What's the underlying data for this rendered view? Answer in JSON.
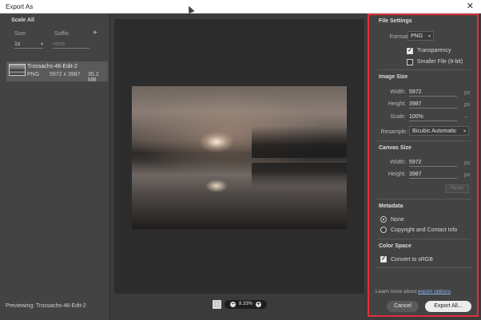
{
  "window": {
    "title": "Export As",
    "close_glyph": "✕"
  },
  "left": {
    "heading": "Scale All",
    "size_label": "Size:",
    "suffix_label": "Suffix:",
    "add_glyph": "+",
    "size_value": "1x",
    "suffix_placeholder": "none",
    "file": {
      "name": "Trossachs-46-Edit-2",
      "type": "PNG",
      "dimensions": "5972 x 3987",
      "size": "35.2 MB"
    },
    "previewing": "Previewing: Trossachs-46-Edit-2"
  },
  "zoom": {
    "value": "8.33%",
    "minus": "−",
    "plus": "+",
    "crop_glyph": "⬚"
  },
  "file_settings": {
    "title": "File Settings",
    "format_label": "Format:",
    "format_value": "PNG",
    "transparency_label": "Transparency",
    "transparency_checked": true,
    "smaller_label": "Smaller File (8-bit)",
    "smaller_checked": false
  },
  "image_size": {
    "title": "Image Size",
    "width_label": "Width:",
    "width_value": "5972",
    "height_label": "Height:",
    "height_value": "3987",
    "scale_label": "Scale:",
    "scale_value": "100%",
    "unit": "px",
    "resample_label": "Resample:",
    "resample_value": "Bicubic Automatic"
  },
  "canvas_size": {
    "title": "Canvas Size",
    "width_label": "Width:",
    "width_value": "5972",
    "height_label": "Height:",
    "height_value": "3987",
    "unit": "px",
    "reset_label": "Reset"
  },
  "metadata": {
    "title": "Metadata",
    "option_none": "None",
    "option_copyright": "Copyright and Contact Info",
    "selected": "none"
  },
  "color_space": {
    "title": "Color Space",
    "convert_label": "Convert to sRGB",
    "convert_checked": true
  },
  "footer": {
    "learn_prefix": "Learn more about ",
    "learn_link": "export options",
    "learn_suffix": ".",
    "cancel_label": "Cancel",
    "export_label": "Export All..."
  },
  "colors": {
    "highlight_border": "#e0303a",
    "panel_bg": "#434343",
    "preview_bg": "#2c2c2c"
  }
}
